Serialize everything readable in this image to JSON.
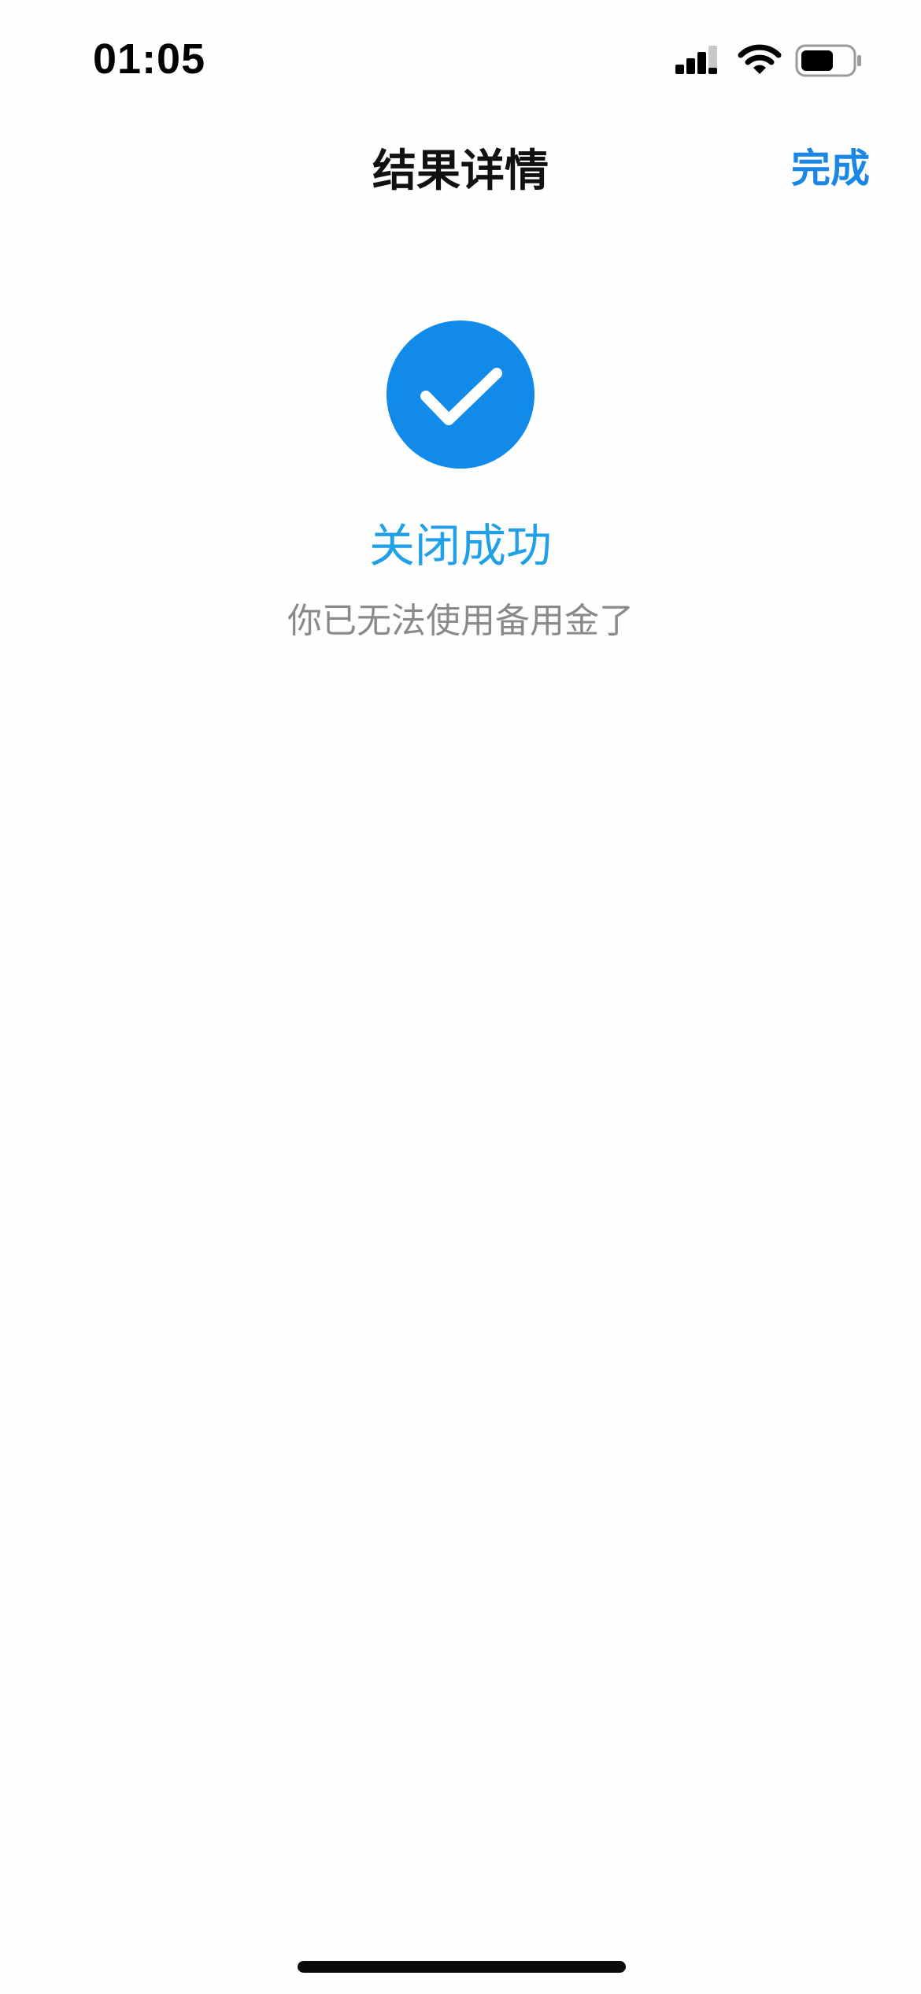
{
  "status_bar": {
    "time": "01:05",
    "icons": [
      "signal-icon",
      "wifi-icon",
      "battery-icon"
    ]
  },
  "nav": {
    "title": "结果详情",
    "done_label": "完成"
  },
  "result": {
    "icon": "checkmark-icon",
    "title": "关闭成功",
    "subtitle": "你已无法使用备用金了"
  },
  "colors": {
    "accent": "#1a87e6",
    "success_circle": "#128ae9",
    "result_title": "#1fa0e8",
    "subtitle": "#8a8a8a"
  }
}
